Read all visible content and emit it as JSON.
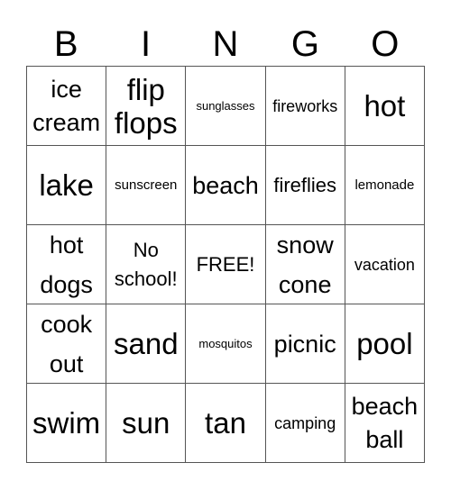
{
  "header": [
    "B",
    "I",
    "N",
    "G",
    "O"
  ],
  "cells": [
    "ice cream",
    "flip flops",
    "sunglasses",
    "fireworks",
    "hot",
    "lake",
    "sunscreen",
    "beach",
    "fireflies",
    "lemonade",
    "hot dogs",
    "No school!",
    "FREE!",
    "snow cone",
    "vacation",
    "cook out",
    "sand",
    "mosquitos",
    "picnic",
    "pool",
    "swim",
    "sun",
    "tan",
    "camping",
    "beach ball"
  ]
}
